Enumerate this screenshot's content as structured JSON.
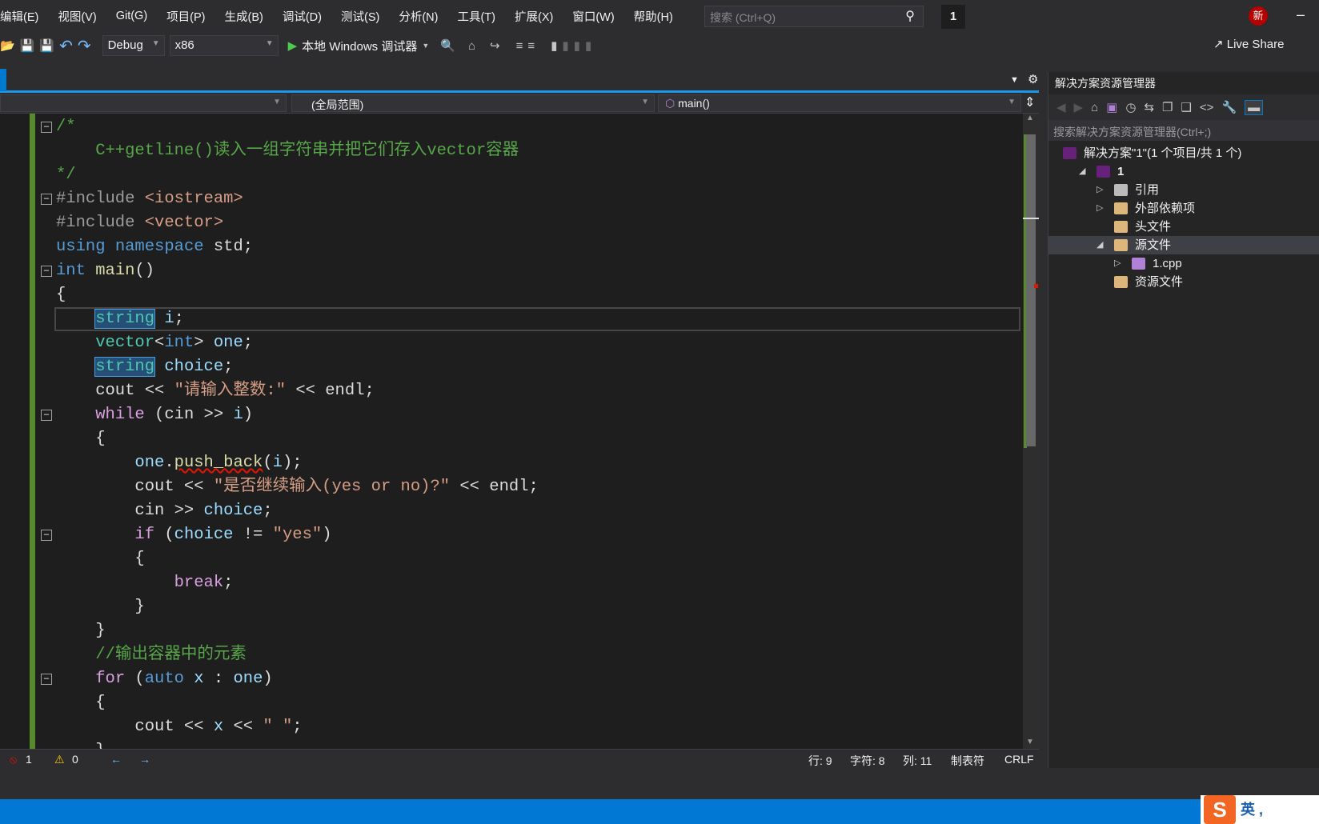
{
  "menu": [
    "编辑(E)",
    "视图(V)",
    "Git(G)",
    "项目(P)",
    "生成(B)",
    "调试(D)",
    "测试(S)",
    "分析(N)",
    "工具(T)",
    "扩展(X)",
    "窗口(W)",
    "帮助(H)"
  ],
  "search": {
    "placeholder": "搜索 (Ctrl+Q)"
  },
  "solution_badge": "1",
  "new_badge": "新",
  "toolbar": {
    "config": "Debug",
    "platform": "x86",
    "run_label": "本地 Windows 调试器",
    "live_share": "Live Share"
  },
  "nav": {
    "scope": "(全局范围)",
    "member": "main()"
  },
  "code": [
    [
      [
        "/*",
        "c"
      ]
    ],
    [
      [
        "    C++getline()读入一组字符串并把它们存入vector容器",
        "c"
      ]
    ],
    [
      [
        "*/",
        "c"
      ]
    ],
    [
      [
        "#include ",
        "p"
      ],
      [
        "<iostream>",
        "s"
      ]
    ],
    [
      [
        "#include ",
        "p"
      ],
      [
        "<vector>",
        "s"
      ]
    ],
    [
      [
        "using",
        "k"
      ],
      [
        " "
      ],
      [
        "namespace",
        "k"
      ],
      [
        " std;"
      ]
    ],
    [
      [
        "int",
        "k"
      ],
      [
        " "
      ],
      [
        "main",
        "f"
      ],
      [
        "()"
      ]
    ],
    [
      [
        "{"
      ]
    ],
    [
      [
        "    "
      ],
      [
        "string",
        "t h"
      ],
      [
        " "
      ],
      [
        "i",
        "v"
      ],
      [
        ";"
      ]
    ],
    [
      [
        "    "
      ],
      [
        "vector",
        "t"
      ],
      [
        "<"
      ],
      [
        "int",
        "k"
      ],
      [
        "> "
      ],
      [
        "one",
        "v"
      ],
      [
        ";"
      ]
    ],
    [
      [
        "    "
      ],
      [
        "string",
        "t h"
      ],
      [
        " "
      ],
      [
        "choice",
        "v"
      ],
      [
        ";"
      ]
    ],
    [
      [
        "    cout << "
      ],
      [
        "\"请输入整数:\"",
        "s"
      ],
      [
        " << endl;"
      ]
    ],
    [
      [
        "    "
      ],
      [
        "while",
        "b"
      ],
      [
        " (cin >> "
      ],
      [
        "i",
        "v"
      ],
      [
        ")"
      ]
    ],
    [
      [
        "    {"
      ]
    ],
    [
      [
        "        "
      ],
      [
        "one",
        "v"
      ],
      [
        "."
      ],
      [
        "push_back",
        "f sq"
      ],
      [
        "("
      ],
      [
        "i",
        "v"
      ],
      [
        ");"
      ]
    ],
    [
      [
        "        cout << "
      ],
      [
        "\"是否继续输入(yes or no)?\"",
        "s"
      ],
      [
        " << endl;"
      ]
    ],
    [
      [
        "        cin >> "
      ],
      [
        "choice",
        "v"
      ],
      [
        ";"
      ]
    ],
    [
      [
        "        "
      ],
      [
        "if",
        "b"
      ],
      [
        " ("
      ],
      [
        "choice",
        "v"
      ],
      [
        " != "
      ],
      [
        "\"yes\"",
        "s"
      ],
      [
        ")"
      ]
    ],
    [
      [
        "        {"
      ]
    ],
    [
      [
        "            "
      ],
      [
        "break",
        "b"
      ],
      [
        ";"
      ]
    ],
    [
      [
        "        }"
      ]
    ],
    [
      [
        "    }"
      ]
    ],
    [
      [
        "    "
      ],
      [
        "//输出容器中的元素",
        "c"
      ]
    ],
    [
      [
        "    "
      ],
      [
        "for",
        "b"
      ],
      [
        " ("
      ],
      [
        "auto",
        "k"
      ],
      [
        " "
      ],
      [
        "x",
        "v"
      ],
      [
        " : "
      ],
      [
        "one",
        "v"
      ],
      [
        ")"
      ]
    ],
    [
      [
        "    {"
      ]
    ],
    [
      [
        "        cout << "
      ],
      [
        "x",
        "v"
      ],
      [
        " << "
      ],
      [
        "\" \"",
        "s"
      ],
      [
        ";"
      ]
    ],
    [
      [
        "    }"
      ]
    ]
  ],
  "status": {
    "errors": "1",
    "warnings": "0",
    "line": "行: 9",
    "char": "字符: 8",
    "col": "列: 11",
    "tabs": "制表符",
    "eol": "CRLF"
  },
  "solution_explorer": {
    "title": "解决方案资源管理器",
    "search_placeholder": "搜索解决方案资源管理器(Ctrl+;)",
    "items": [
      {
        "label": "解决方案\"1\"(1 个项目/共 1 个)",
        "level": 0,
        "icon": "solution-icon"
      },
      {
        "label": "1",
        "level": 1,
        "icon": "cpp-project-icon",
        "expanded": true
      },
      {
        "label": "引用",
        "level": 2,
        "icon": "references-icon",
        "expanded": false
      },
      {
        "label": "外部依赖项",
        "level": 2,
        "icon": "external-deps-icon",
        "expanded": false
      },
      {
        "label": "头文件",
        "level": 2,
        "icon": "filter-folder-icon"
      },
      {
        "label": "源文件",
        "level": 2,
        "icon": "filter-folder-icon",
        "expanded": true,
        "selected": true
      },
      {
        "label": "1.cpp",
        "level": 3,
        "icon": "cpp-file-icon",
        "expanded": false
      },
      {
        "label": "资源文件",
        "level": 2,
        "icon": "filter-folder-icon"
      }
    ]
  },
  "ime": {
    "mode": "英"
  }
}
